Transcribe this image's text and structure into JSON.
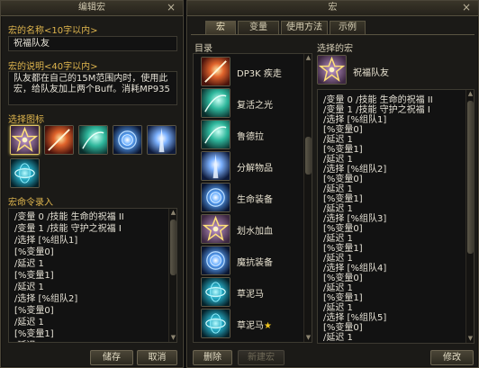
{
  "left_window": {
    "title": "编辑宏",
    "name_label": "宏的名称<10字以内>",
    "name_value": "祝福队友",
    "desc_label": "宏的说明<40字以内>",
    "desc_value": "队友都在自己的15M范围内时，使用此宏，给队友加上两个Buff。消耗MP935",
    "icon_label": "选择图标",
    "icons": [
      "pentagram-star-icon",
      "sunburst-slash-icon",
      "teal-swirl-icon",
      "blue-vortex-icon",
      "light-pillar-icon",
      "cyan-tornado-icon"
    ],
    "command_label": "宏命令录入",
    "commands": [
      "/变量 0 /技能 生命的祝福 II",
      "/变量 1 /技能 守护之祝福 I",
      "/选择 [%组队1]",
      "[%变量0]",
      "/延迟 1",
      "[%变量1]",
      "/延迟 1",
      "/选择 [%组队2]",
      "[%变量0]",
      "/延迟 1",
      "[%变量1]",
      "/延迟 1",
      "/选择 [%组队3]",
      "[%变量0]"
    ],
    "save_button": "储存",
    "cancel_button": "取消",
    "close_glyph": "×"
  },
  "right_window": {
    "title": "宏",
    "close_glyph": "×",
    "tabs": [
      "宏",
      "变量",
      "使用方法",
      "示例"
    ],
    "active_tab": 0,
    "list_label": "目录",
    "items": [
      {
        "label": "DP3K 疾走",
        "icon": "sunburst-slash-icon"
      },
      {
        "label": "复活之光",
        "icon": "teal-swirl-icon"
      },
      {
        "label": "鲁德拉",
        "icon": "teal-swirl-icon"
      },
      {
        "label": "分解物品",
        "icon": "light-pillar-icon"
      },
      {
        "label": "生命装备",
        "icon": "blue-vortex-icon"
      },
      {
        "label": "划水加血",
        "icon": "pentagram-star-icon"
      },
      {
        "label": "魔抗装备",
        "icon": "blue-vortex-icon"
      },
      {
        "label": "草泥马",
        "icon": "cyan-tornado-icon"
      },
      {
        "label": "草泥马",
        "icon": "cyan-tornado-icon",
        "star": "★"
      }
    ],
    "selected_label": "选择的宏",
    "selected_name": "祝福队友",
    "selected_icon": "pentagram-star-icon",
    "commands": [
      "/变量 0 /技能 生命的祝福 II",
      "/变量 1 /技能 守护之祝福 I",
      "/选择 [%组队1]",
      "[%变量0]",
      "/延迟 1",
      "[%变量1]",
      "/延迟 1",
      "/选择 [%组队2]",
      "[%变量0]",
      "/延迟 1",
      "[%变量1]",
      "/延迟 1",
      "/选择 [%组队3]",
      "[%变量0]",
      "/延迟 1",
      "[%变量1]",
      "/延迟 1",
      "/选择 [%组队4]",
      "[%变量0]",
      "/延迟 1",
      "[%变量1]",
      "/延迟 1",
      "/选择 [%组队5]",
      "[%变量0]",
      "/延迟 1"
    ],
    "delete_button": "删除",
    "new_button": "新建宏",
    "edit_button": "修改"
  },
  "colors": {
    "label_gold": "#e0b64e",
    "selected_border": "#e2c866",
    "star": "#f0c51f"
  }
}
